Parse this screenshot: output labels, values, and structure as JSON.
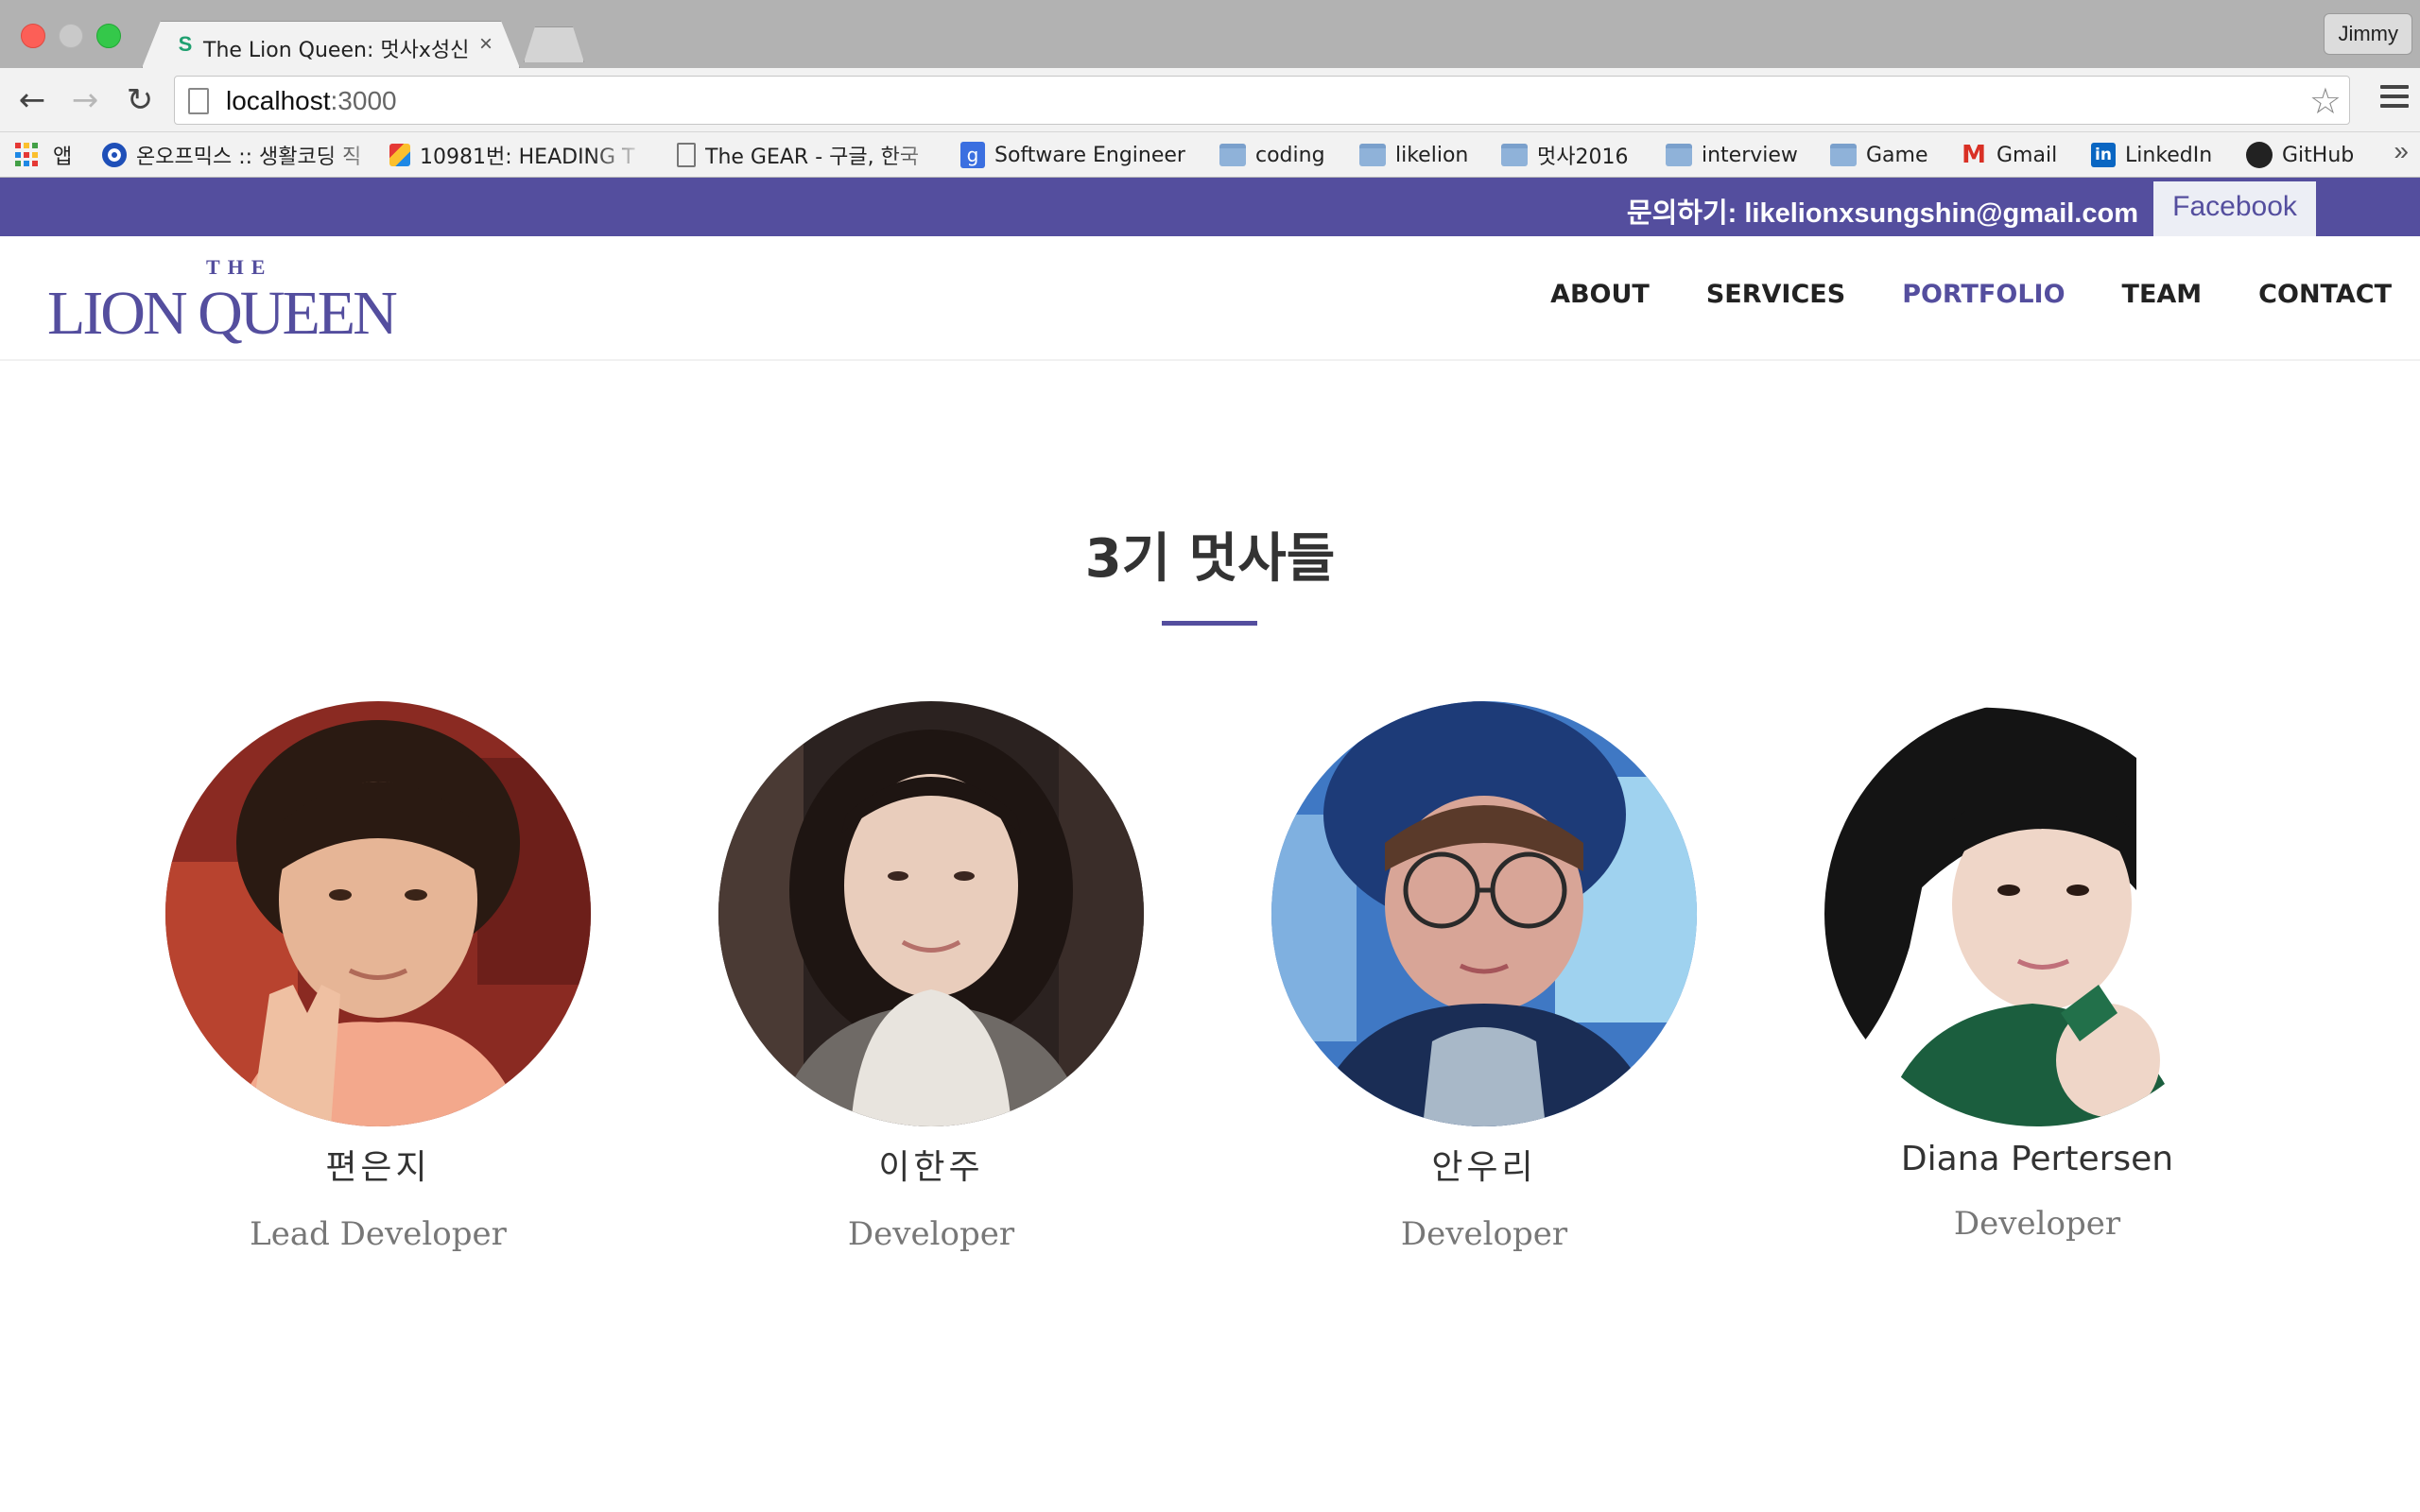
{
  "browser": {
    "tab_title": "The Lion Queen: 멋사x성신",
    "tab_favicon": "S",
    "tab_close": "×",
    "profile_name": "Jimmy",
    "url_host": "localhost",
    "url_port": ":3000",
    "bookmarks": [
      {
        "label": "앱",
        "icon": "apps-grid-icon"
      },
      {
        "label": "온오프믹스 :: 생활코딩 직",
        "icon": "onoffmix-icon"
      },
      {
        "label": "10981번: HEADING T",
        "icon": "boj-icon"
      },
      {
        "label": "The GEAR - 구글, 한국",
        "icon": "page-icon"
      },
      {
        "label": "Software Engineer",
        "icon": "google-icon"
      },
      {
        "label": "coding",
        "icon": "folder-icon"
      },
      {
        "label": "likelion",
        "icon": "folder-icon"
      },
      {
        "label": "멋사2016",
        "icon": "folder-icon"
      },
      {
        "label": "interview",
        "icon": "folder-icon"
      },
      {
        "label": "Game",
        "icon": "folder-icon"
      },
      {
        "label": "Gmail",
        "icon": "gmail-icon"
      },
      {
        "label": "LinkedIn",
        "icon": "linkedin-icon"
      },
      {
        "label": "GitHub",
        "icon": "github-icon"
      }
    ],
    "bookmarks_more": "»"
  },
  "topbar": {
    "inquiry": "문의하기: likelionxsungshin@gmail.com",
    "facebook": "Facebook"
  },
  "header": {
    "logo_the": "THE",
    "logo_name": "LION QUEEN",
    "nav": [
      {
        "label": "ABOUT",
        "active": false
      },
      {
        "label": "SERVICES",
        "active": false
      },
      {
        "label": "PORTFOLIO",
        "active": true
      },
      {
        "label": "TEAM",
        "active": false
      },
      {
        "label": "CONTACT",
        "active": false
      }
    ]
  },
  "team": {
    "title": "3기 멋사들",
    "members": [
      {
        "name": "편은지",
        "role": "Lead Developer"
      },
      {
        "name": "이한주",
        "role": "Developer"
      },
      {
        "name": "안우리",
        "role": "Developer"
      },
      {
        "name": "Diana Pertersen",
        "role": "Developer"
      }
    ]
  },
  "colors": {
    "brand": "#544e9e",
    "topbar_bg": "#544e9e",
    "nav_active": "#544e9e",
    "text_dark": "#333333",
    "role_gray": "#777777"
  }
}
